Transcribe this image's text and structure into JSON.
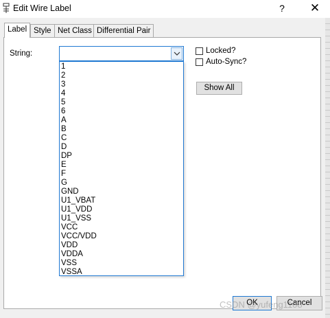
{
  "window": {
    "title": "Edit Wire Label",
    "help_label": "?",
    "close_label": "✕"
  },
  "tabs": [
    {
      "label": "Label"
    },
    {
      "label": "Style"
    },
    {
      "label": "Net Class"
    },
    {
      "label": "Differential Pair"
    }
  ],
  "form": {
    "string_label": "String:",
    "string_value": "",
    "locked_label": "Locked?",
    "autosync_label": "Auto-Sync?",
    "show_all_label": "Show All"
  },
  "dropdown": {
    "options": [
      "1",
      "2",
      "3",
      "4",
      "5",
      "6",
      "A",
      "B",
      "C",
      "D",
      "DP",
      "E",
      "F",
      "G",
      "GND",
      "U1_VBAT",
      "U1_VDD",
      "U1_VSS",
      "VCC",
      "VCC/VDD",
      "VDD",
      "VDDA",
      "VSS",
      "VSSA"
    ]
  },
  "footer": {
    "ok_label": "OK",
    "cancel_label": "Cancel",
    "watermark": "CSDN @yufeng1108"
  },
  "colors": {
    "focus_border": "#1e78d2",
    "dialog_bg": "#f0f0f0"
  }
}
